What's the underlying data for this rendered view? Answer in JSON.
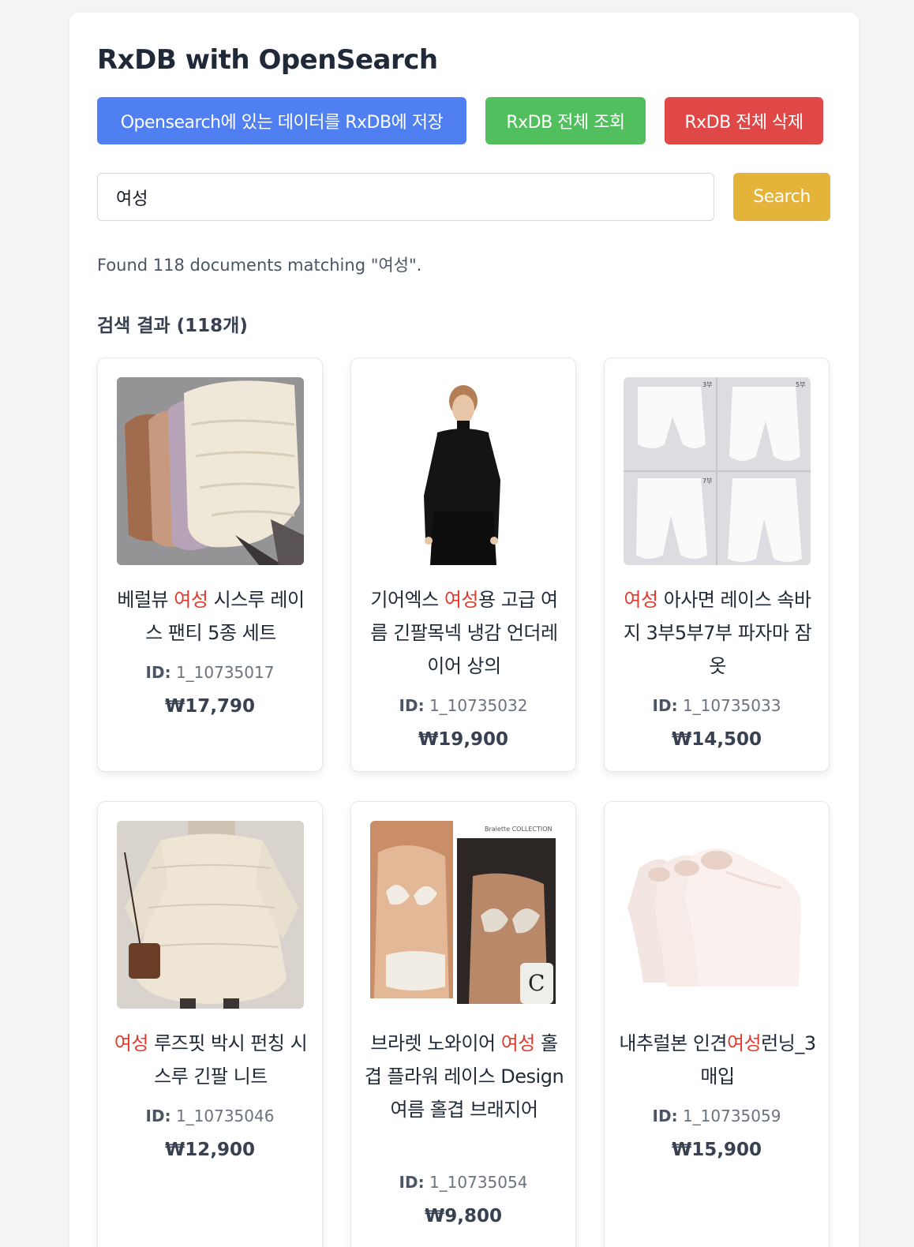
{
  "app": {
    "title": "RxDB with OpenSearch"
  },
  "toolbar": {
    "sync_label": "Opensearch에 있는 데이터를 RxDB에 저장",
    "fetch_all_label": "RxDB 전체 조회",
    "delete_all_label": "RxDB 전체 삭제"
  },
  "search": {
    "value": "여성",
    "button_label": "Search"
  },
  "status": {
    "found_text": "Found 118 documents matching \"여성\"."
  },
  "results": {
    "heading": "검색 결과 (118개)",
    "highlight_term": "여성",
    "id_label": "ID:",
    "items": [
      {
        "title_before": "베럴뷰 ",
        "title_hl": "여성",
        "title_after": " 시스루 레이스 팬티 5종 세트",
        "id": "1_10735017",
        "price": "₩17,790",
        "image": "lace-panties-photo"
      },
      {
        "title_before": "기어엑스 ",
        "title_hl": "여성",
        "title_after": "용 고급 여름 긴팔목넥 냉감 언더레이어 상의",
        "id": "1_10735032",
        "price": "₩19,900",
        "image": "black-longsleeve-top-photo"
      },
      {
        "title_before": "",
        "title_hl": "여성",
        "title_after": " 아사면 레이스 속바지 3부5부7부 파자마 잠옷",
        "id": "1_10735033",
        "price": "₩14,500",
        "image": "white-lace-shorts-photo"
      },
      {
        "title_before": "",
        "title_hl": "여성",
        "title_after": " 루즈핏 박시 펀칭 시스루 긴팔 니트",
        "id": "1_10735046",
        "price": "₩12,900",
        "image": "crochet-knit-sweater-photo"
      },
      {
        "title_before": "브라렛 노와이어 ",
        "title_hl": "여성",
        "title_after": " 홀겹 플라워 레이스 Design 여름 홀겹 브래지어",
        "id": "1_10735054",
        "price": "₩9,800",
        "image": "lace-bralette-photo"
      },
      {
        "title_before": "내추럴본 인견",
        "title_hl": "여성",
        "title_after": "런닝_3매입",
        "id": "1_10735059",
        "price": "₩15,900",
        "image": "pink-tank-tops-photo"
      }
    ]
  },
  "image_text": {
    "shorts_labels": [
      "3부",
      "5부",
      "7부"
    ],
    "bralette_brand": "Bralette  COLLECTION"
  },
  "colors": {
    "sync_button": "#4f7ff0",
    "fetch_all_button": "#52bf5f",
    "delete_all_button": "#e04848",
    "search_button": "#e3b33a",
    "highlight": "#e23b2e"
  }
}
